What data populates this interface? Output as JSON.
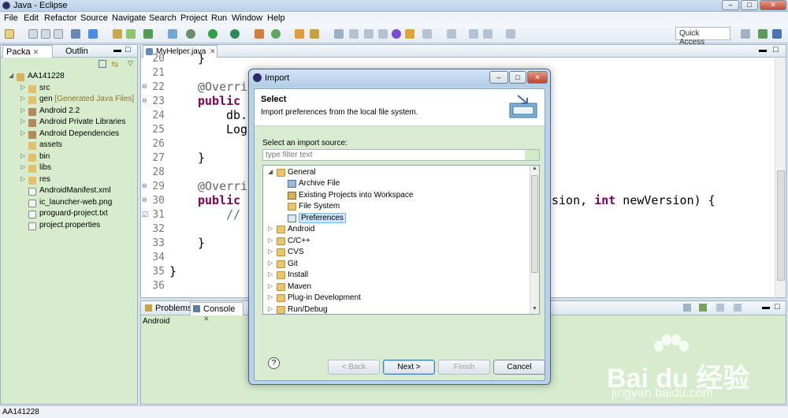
{
  "window": {
    "title": "Java - Eclipse"
  },
  "menu": [
    "File",
    "Edit",
    "Refactor",
    "Source",
    "Navigate",
    "Search",
    "Project",
    "Run",
    "Window",
    "Help"
  ],
  "toolbar": {
    "quick_access": "Quick Access"
  },
  "left_panel": {
    "tabs": [
      "Packa",
      "Outlin"
    ],
    "project": "AA141228",
    "items": [
      {
        "label": "src",
        "extra": ""
      },
      {
        "label": "gen",
        "extra": "[Generated Java Files]"
      },
      {
        "label": "Android 2.2",
        "extra": ""
      },
      {
        "label": "Android Private Libraries",
        "extra": ""
      },
      {
        "label": "Android Dependencies",
        "extra": ""
      },
      {
        "label": "assets",
        "extra": ""
      },
      {
        "label": "bin",
        "extra": ""
      },
      {
        "label": "libs",
        "extra": ""
      },
      {
        "label": "res",
        "extra": ""
      },
      {
        "label": "AndroidManifest.xml",
        "extra": ""
      },
      {
        "label": "ic_launcher-web.png",
        "extra": ""
      },
      {
        "label": "proguard-project.txt",
        "extra": ""
      },
      {
        "label": "project.properties",
        "extra": ""
      }
    ]
  },
  "editor": {
    "tab": "MyHelper.java",
    "line_numbers": [
      "20",
      "21",
      "22",
      "23",
      "24",
      "25",
      "26",
      "27",
      "28",
      "29",
      "30",
      "31",
      "32",
      "33",
      "34",
      "35",
      "36"
    ],
    "code": {
      "l20": "}",
      "l22": "@Overrid",
      "l23_kw": "public",
      "l24": "db.",
      "l25": "Log",
      "l27": "}",
      "l29": "@Overrid",
      "l30_kw": "public",
      "l30_tail_a": "sion, ",
      "l30_tail_kw": "int",
      "l30_tail_b": " newVersion) {",
      "l31": "//",
      "l33": "}",
      "l35": "}"
    }
  },
  "console": {
    "tabs": [
      "Problems",
      "Console"
    ],
    "subtitle": "Android"
  },
  "status": {
    "text": "AA141228"
  },
  "watermark": {
    "logo": "Bai du 经验",
    "url": "jingyan.baidu.com"
  },
  "dialog": {
    "title": "Import",
    "header_title": "Select",
    "header_desc": "Import preferences from the local file system.",
    "source_label": "Select an import source:",
    "filter_placeholder": "type filter text",
    "tree": [
      {
        "label": "General",
        "level": 0,
        "expanded": true
      },
      {
        "label": "Archive File",
        "level": 1
      },
      {
        "label": "Existing Projects into Workspace",
        "level": 1
      },
      {
        "label": "File System",
        "level": 1
      },
      {
        "label": "Preferences",
        "level": 1,
        "selected": true
      },
      {
        "label": "Android",
        "level": 0
      },
      {
        "label": "C/C++",
        "level": 0
      },
      {
        "label": "CVS",
        "level": 0
      },
      {
        "label": "Git",
        "level": 0
      },
      {
        "label": "Install",
        "level": 0
      },
      {
        "label": "Maven",
        "level": 0
      },
      {
        "label": "Plug-in Development",
        "level": 0
      },
      {
        "label": "Run/Debug",
        "level": 0
      }
    ],
    "buttons": {
      "help": "?",
      "back": "< Back",
      "next": "Next >",
      "finish": "Finish",
      "cancel": "Cancel"
    }
  }
}
